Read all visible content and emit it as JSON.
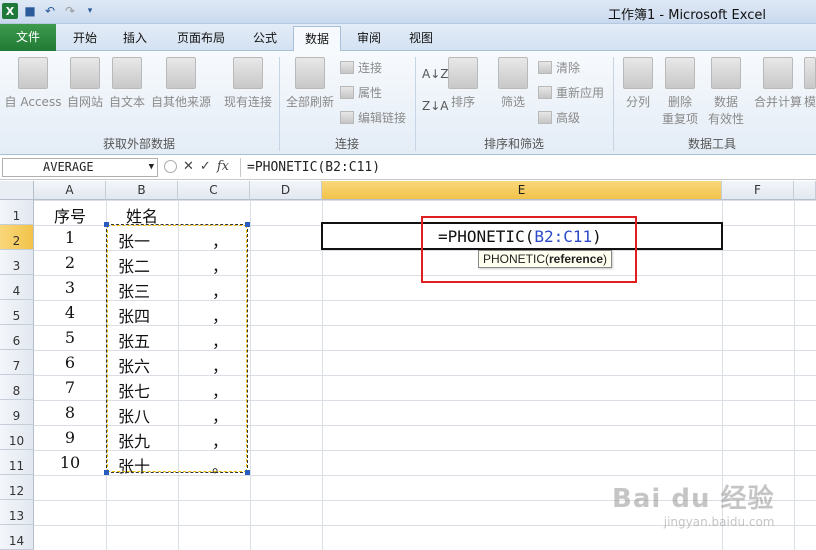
{
  "window": {
    "title": "工作簿1 - Microsoft Excel"
  },
  "tabs": [
    {
      "label": "文件",
      "kind": "file"
    },
    {
      "label": "开始"
    },
    {
      "label": "插入"
    },
    {
      "label": "页面布局"
    },
    {
      "label": "公式"
    },
    {
      "label": "数据",
      "active": true
    },
    {
      "label": "审阅"
    },
    {
      "label": "视图"
    }
  ],
  "ribbon": {
    "external": {
      "access": "自 Access",
      "web": "自网站",
      "text": "自文本",
      "other": "自其他来源",
      "existing": "现有连接",
      "group": "获取外部数据"
    },
    "connections": {
      "refresh": "全部刷新",
      "conn": "连接",
      "props": "属性",
      "edit_links": "编辑链接",
      "group": "连接"
    },
    "sortfilter": {
      "sort": "排序",
      "filter": "筛选",
      "clear": "清除",
      "reapply": "重新应用",
      "advanced": "高级",
      "group": "排序和筛选"
    },
    "tools": {
      "split": "分列",
      "remove_dup_1": "删除",
      "remove_dup_2": "重复项",
      "validation_1": "数据",
      "validation_2": "有效性",
      "consolidate": "合并计算",
      "more": "模",
      "group": "数据工具"
    }
  },
  "formula_bar": {
    "name_box": "AVERAGE",
    "formula": "=PHONETIC(B2:C11)",
    "fx": "fx"
  },
  "grid": {
    "columns": [
      "A",
      "B",
      "C",
      "D",
      "E",
      "F"
    ],
    "rows": [
      "1",
      "2",
      "3",
      "4",
      "5",
      "6",
      "7",
      "8",
      "9",
      "10",
      "11",
      "12",
      "13",
      "14"
    ],
    "header_row": {
      "a": "序号",
      "b": "姓名"
    },
    "data": [
      {
        "a": "1",
        "b": "张一",
        "c": "，"
      },
      {
        "a": "2",
        "b": "张二",
        "c": "，"
      },
      {
        "a": "3",
        "b": "张三",
        "c": "，"
      },
      {
        "a": "4",
        "b": "张四",
        "c": "，"
      },
      {
        "a": "5",
        "b": "张五",
        "c": "，"
      },
      {
        "a": "6",
        "b": "张六",
        "c": "，"
      },
      {
        "a": "7",
        "b": "张七",
        "c": "，"
      },
      {
        "a": "8",
        "b": "张八",
        "c": "，"
      },
      {
        "a": "9",
        "b": "张九",
        "c": "，"
      },
      {
        "a": "10",
        "b": "张十",
        "c": "。"
      }
    ],
    "edit_cell": {
      "formula_prefix": "=PHONETIC(",
      "formula_ref": "B2:C11",
      "formula_suffix": ")",
      "tooltip_fn": "PHONETIC(",
      "tooltip_arg": "reference",
      "tooltip_end": ")"
    }
  },
  "watermark": {
    "brand": "Bai du 经验",
    "url": "jingyan.baidu.com"
  }
}
